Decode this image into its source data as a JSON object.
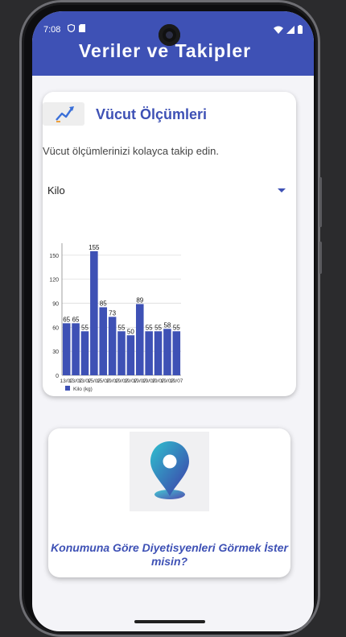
{
  "status_bar": {
    "time": "7:08"
  },
  "app_bar": {
    "title": "Veriler ve Takipler"
  },
  "card_measurements": {
    "title": "Vücut Ölçümleri",
    "description": "Vücut ölçümlerinizi kolayca takip edin.",
    "selector": {
      "selected": "Kilo"
    }
  },
  "chart_data": {
    "type": "bar",
    "categories": [
      "13/07",
      "13/07",
      "13/07",
      "15/07",
      "15/07",
      "19/07",
      "19/07",
      "19/07",
      "19/07",
      "19/07",
      "19/07",
      "19/07",
      "19/07"
    ],
    "series": [
      {
        "name": "Kilo (kg)",
        "values": [
          65,
          65,
          55,
          155,
          85,
          73,
          55,
          50,
          89,
          55,
          55,
          58,
          55
        ]
      }
    ],
    "bar_labels": [
      "65",
      "65",
      "55",
      "155",
      "85",
      "73",
      "55",
      "50",
      "89",
      "55",
      "55",
      "58",
      "55"
    ],
    "x_tick_labels": [
      "13/07",
      "13/07",
      "13/07",
      "15/07",
      "15/07",
      "19/07",
      "19/07",
      "19/07",
      "19/07",
      "19/07",
      "19/07",
      "19/07",
      "19/07"
    ],
    "y_ticks": [
      "0",
      "30",
      "60",
      "90",
      "120",
      "150"
    ],
    "ylim": [
      0,
      165
    ],
    "grid": true,
    "legend": "bottom-left",
    "bar_color": "#3e51b5"
  },
  "card_location": {
    "text": "Konumuna Göre Diyetisyenleri Görmek İster misin?",
    "icon": "location-pin-icon"
  },
  "colors": {
    "primary": "#3e51b5",
    "background": "#f4f4f8"
  }
}
